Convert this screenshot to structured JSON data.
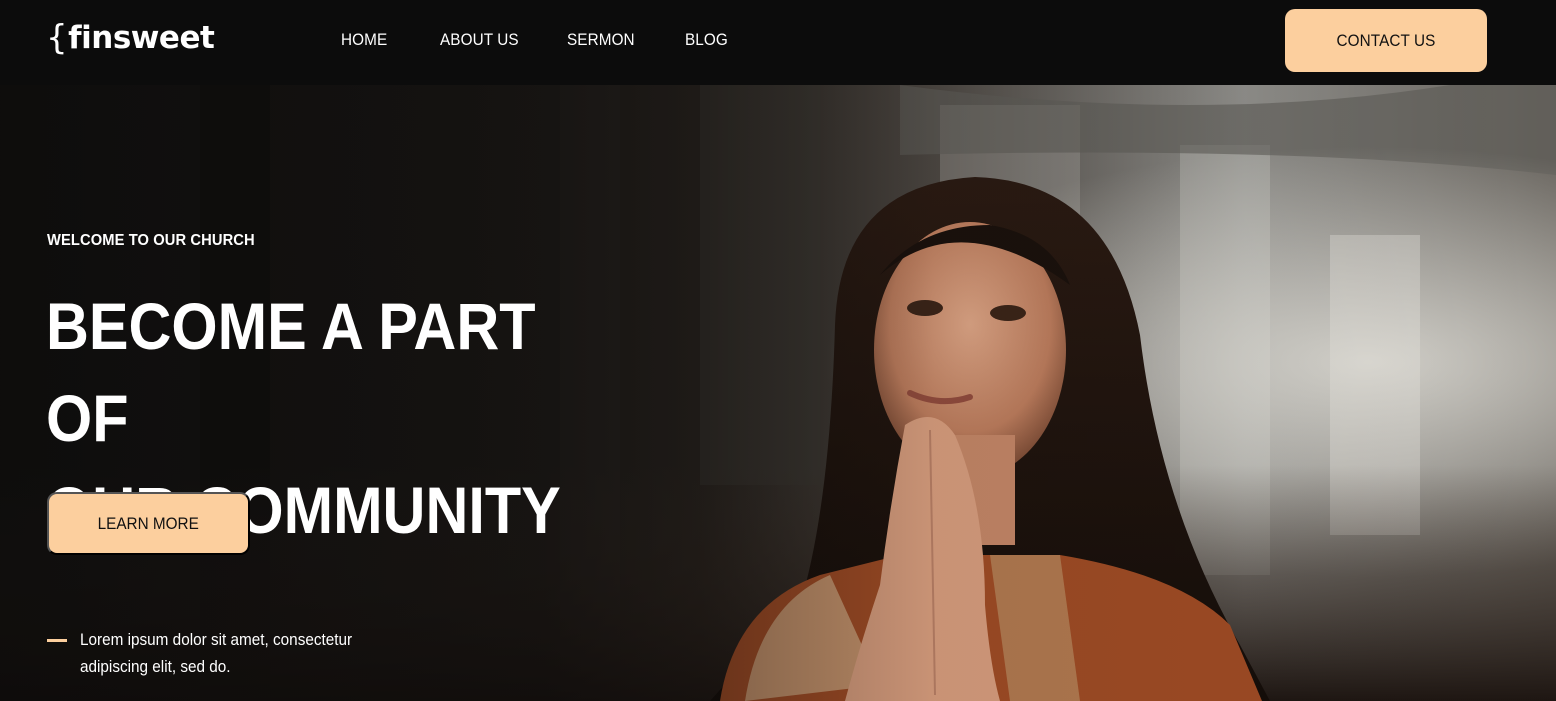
{
  "brand": {
    "logo_text": "finsweet",
    "logo_brace": "{"
  },
  "nav": {
    "links": [
      "HOME",
      "ABOUT US",
      "SERMON",
      "BLOG"
    ],
    "cta": "CONTACT US"
  },
  "hero": {
    "eyebrow": "WELCOME TO OUR CHURCH",
    "headline_line1": "BECOME A PART OF",
    "headline_line2": "OUR COMMUNITY",
    "button": "LEARN MORE",
    "blurb_line1": "Lorem ipsum dolor sit amet, consectetur",
    "blurb_line2": "adipiscing elit, sed do.",
    "image_subject": "woman praying in church"
  },
  "colors": {
    "accent": "#fccf9e",
    "nav_bg": "#0c0c0c",
    "text": "#ffffff",
    "button_text": "#111111"
  }
}
